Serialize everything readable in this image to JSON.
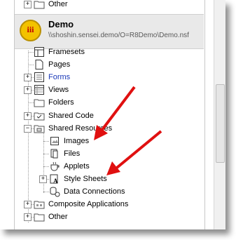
{
  "top_item": {
    "label": "Other"
  },
  "database": {
    "title": "Demo",
    "path": "\\\\shoshin.sensei.demo/O=R8Demo\\Demo.nsf",
    "logo_text": "iii"
  },
  "tree": [
    {
      "label": "Framesets",
      "link": false,
      "expander": ""
    },
    {
      "label": "Pages",
      "link": false,
      "expander": ""
    },
    {
      "label": "Forms",
      "link": true,
      "expander": "+"
    },
    {
      "label": "Views",
      "link": false,
      "expander": "+"
    },
    {
      "label": "Folders",
      "link": false,
      "expander": ""
    },
    {
      "label": "Shared Code",
      "link": false,
      "expander": "+"
    },
    {
      "label": "Shared Resources",
      "link": false,
      "expander": "-"
    },
    {
      "label": "Images",
      "link": false,
      "expander": ""
    },
    {
      "label": "Files",
      "link": false,
      "expander": ""
    },
    {
      "label": "Applets",
      "link": false,
      "expander": ""
    },
    {
      "label": "Style Sheets",
      "link": false,
      "expander": "+"
    },
    {
      "label": "Data Connections",
      "link": false,
      "expander": ""
    },
    {
      "label": "Composite Applications",
      "link": false,
      "expander": "+"
    },
    {
      "label": "Other",
      "link": false,
      "expander": "+"
    }
  ],
  "colors": {
    "arrow": "#e01010",
    "link": "#1a39b8",
    "logo": "#f3c200"
  }
}
